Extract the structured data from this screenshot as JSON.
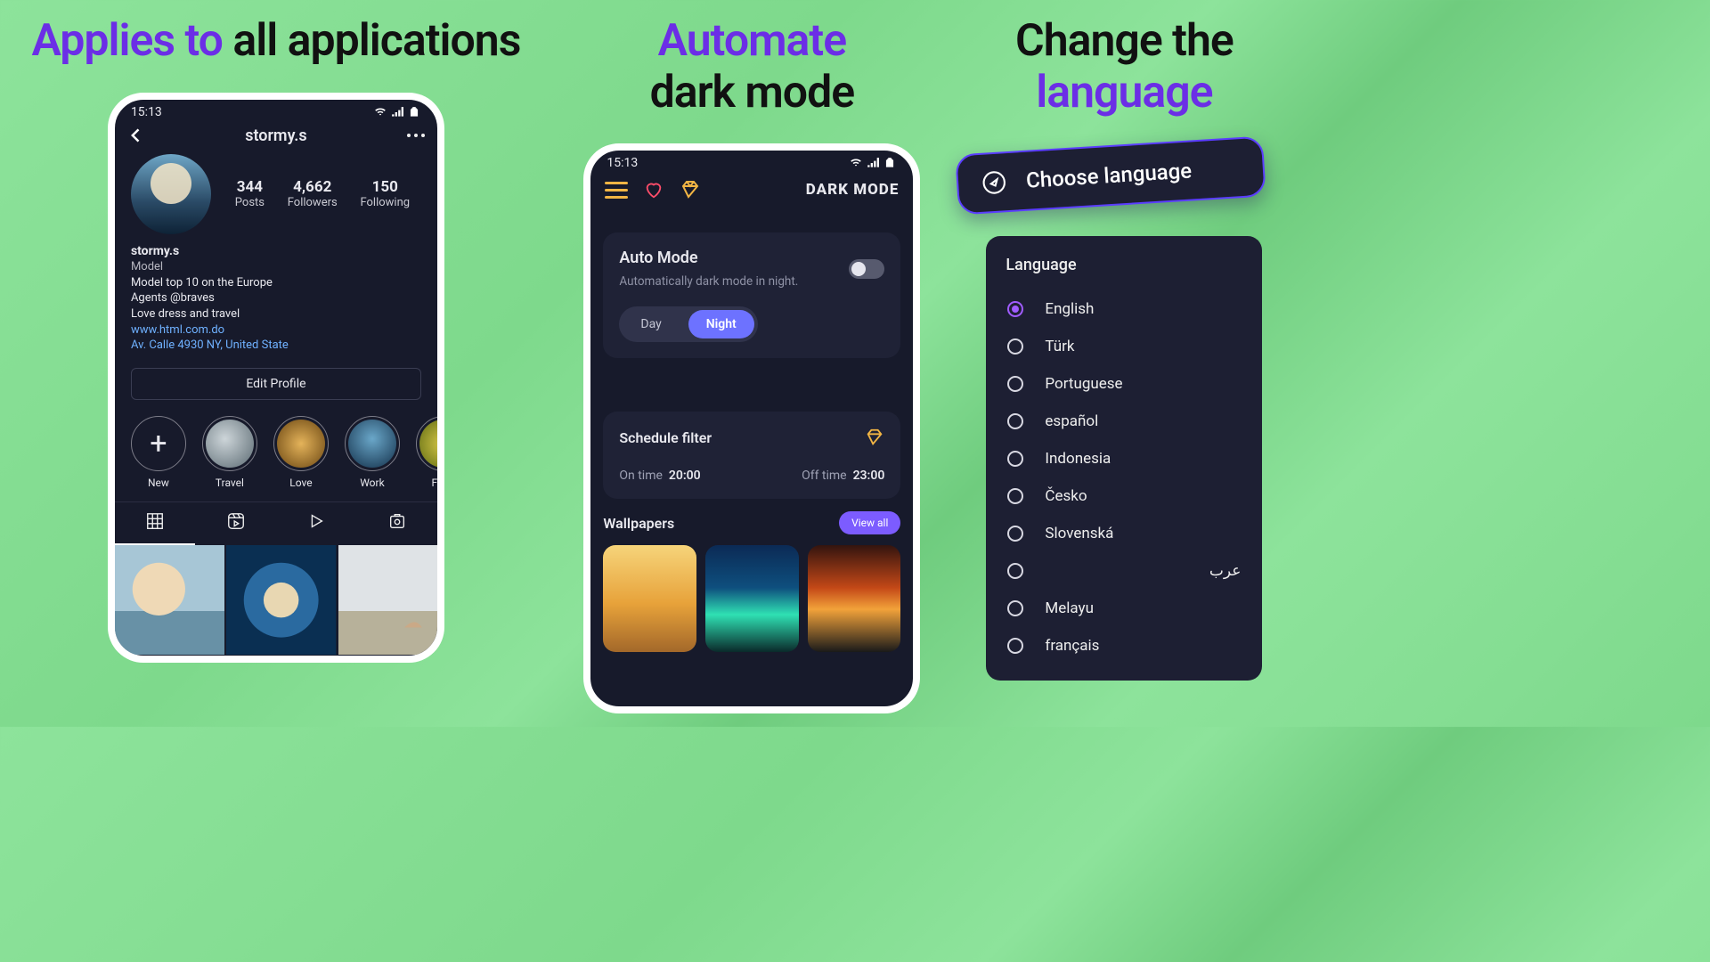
{
  "headlines": {
    "p1a": "Applies to",
    "p1b": "all applications",
    "p2a": "Automate",
    "p2b": "dark mode",
    "p3a": "Change the",
    "p3b": "language"
  },
  "status_time": "15:13",
  "ig": {
    "username": "stormy.s",
    "stats": {
      "posts": {
        "num": "344",
        "lbl": "Posts"
      },
      "followers": {
        "num": "4,662",
        "lbl": "Followers"
      },
      "following": {
        "num": "150",
        "lbl": "Following"
      }
    },
    "bio": {
      "name": "stormy.s",
      "role": "Model",
      "line1": "Model top 10 on the Europe",
      "line2": "Agents @braves",
      "line3": "Love dress and travel",
      "url": "www.html.com.do",
      "addr": "Av. Calle 4930 NY, United State"
    },
    "edit": "Edit Profile",
    "hl": [
      "New",
      "Travel",
      "Love",
      "Work",
      "Food"
    ]
  },
  "dm": {
    "brand": "DARK MODE",
    "auto": {
      "title": "Auto Mode",
      "sub": "Automatically dark mode in night."
    },
    "day": "Day",
    "night": "Night",
    "sched": {
      "title": "Schedule filter",
      "on_lbl": "On time",
      "on": "20:00",
      "off_lbl": "Off time",
      "off": "23:00"
    },
    "wall_title": "Wallpapers",
    "viewall": "View all"
  },
  "lang": {
    "choose": "Choose language",
    "header": "Language",
    "items": [
      "English",
      "Türk",
      "Portuguese",
      "español",
      "Indonesia",
      "Česko",
      "Slovenská",
      "عرب",
      "Melayu",
      "français"
    ],
    "selected": 0
  }
}
